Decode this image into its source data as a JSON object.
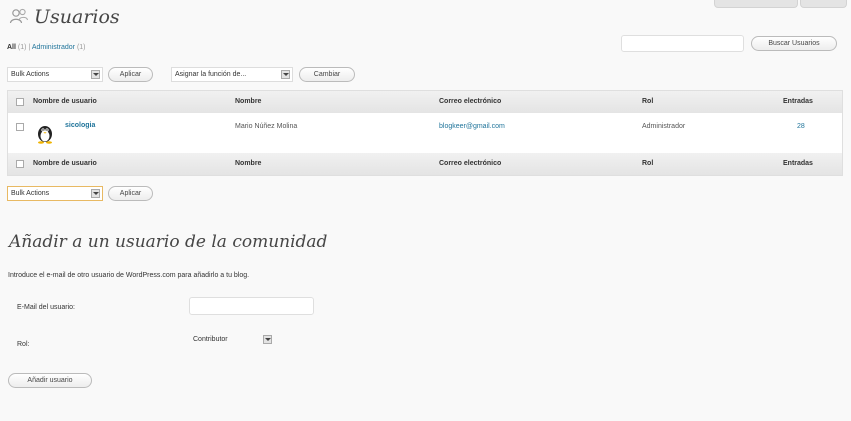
{
  "page": {
    "title": "Usuarios",
    "filters": {
      "all": "All",
      "all_count": "(1)",
      "separator": "|",
      "admin": "Administrador",
      "admin_count": "(1)"
    },
    "search_button": "Buscar Usuarios"
  },
  "toolbar_top": {
    "bulk_select": "Bulk Actions",
    "apply": "Aplicar",
    "assign_role_label": "Asignar la función de...",
    "change": "Cambiar"
  },
  "table": {
    "columns": [
      "Nombre de usuario",
      "Nombre",
      "Correo electrónico",
      "Rol",
      "Entradas"
    ],
    "rows": [
      {
        "username": "sicologia",
        "name": "Mario Núñez Molina",
        "email": "blogkeer@gmail.com",
        "role": "Administrador",
        "posts": "28"
      }
    ]
  },
  "toolbar_bottom": {
    "bulk_select": "Bulk Actions",
    "apply": "Aplicar"
  },
  "add_user": {
    "title": "Añadir a un usuario de la comunidad",
    "description": "Introduce el e-mail de otro usuario de WordPress.com para añadirlo a tu blog.",
    "email_label": "E-Mail del usuario:",
    "email_value": "",
    "role_label": "Rol:",
    "role_value": "Contributor",
    "submit": "Añadir usuario"
  }
}
